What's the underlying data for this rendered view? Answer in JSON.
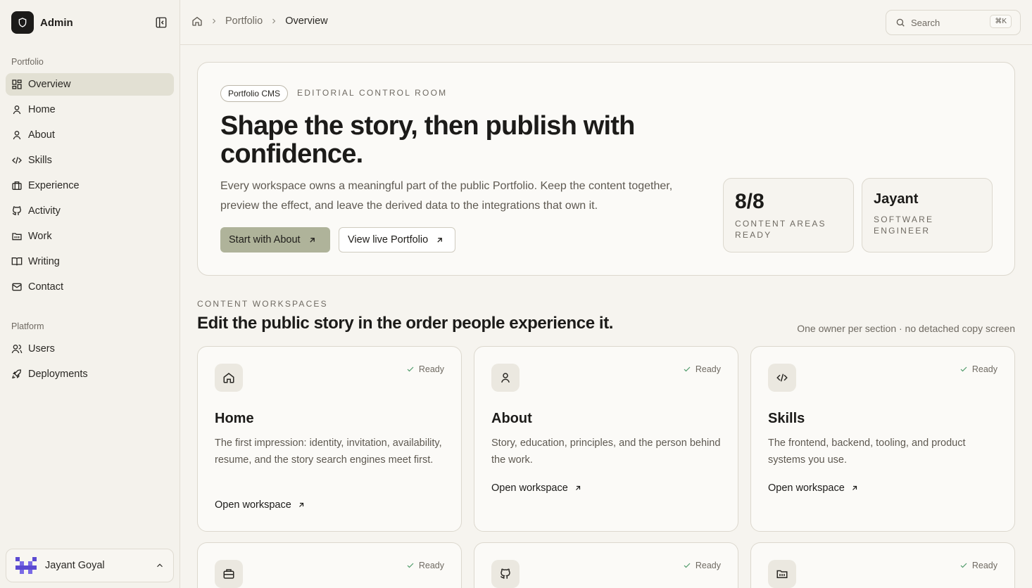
{
  "brand": {
    "name": "Admin"
  },
  "sidebar": {
    "groups": [
      {
        "label": "Portfolio"
      },
      {
        "label": "Platform"
      }
    ],
    "items": [
      {
        "label": "Overview"
      },
      {
        "label": "Home"
      },
      {
        "label": "About"
      },
      {
        "label": "Skills"
      },
      {
        "label": "Experience"
      },
      {
        "label": "Activity"
      },
      {
        "label": "Work"
      },
      {
        "label": "Writing"
      },
      {
        "label": "Contact"
      },
      {
        "label": "Users"
      },
      {
        "label": "Deployments"
      }
    ],
    "user": {
      "name": "Jayant Goyal"
    }
  },
  "header": {
    "breadcrumbs": [
      "Portfolio",
      "Overview"
    ],
    "search": {
      "placeholder": "Search",
      "shortcut": "⌘K"
    }
  },
  "hero": {
    "pill": "Portfolio CMS",
    "eyebrow": "EDITORIAL CONTROL ROOM",
    "title": "Shape the story, then publish with confidence.",
    "description": "Every workspace owns a meaningful part of the public Portfolio. Keep the content together, preview the effect, and leave the derived data to the integrations that own it.",
    "primary_button": "Start with About",
    "secondary_button": "View live Portfolio",
    "stats": [
      {
        "value": "8/8",
        "label": "CONTENT AREAS READY"
      },
      {
        "value": "Jayant",
        "label": "SOFTWARE ENGINEER"
      }
    ]
  },
  "workspaces": {
    "eyebrow": "CONTENT WORKSPACES",
    "title": "Edit the public story in the order people experience it.",
    "note": "One owner per section · no detached copy screen",
    "cards": [
      {
        "title": "Home",
        "status": "Ready",
        "description": "The first impression: identity, invitation, availability, resume, and the story search engines meet first.",
        "link": "Open workspace",
        "icon": "home-icon"
      },
      {
        "title": "About",
        "status": "Ready",
        "description": "Story, education, principles, and the person behind the work.",
        "link": "Open workspace",
        "icon": "user-icon"
      },
      {
        "title": "Skills",
        "status": "Ready",
        "description": "The frontend, backend, tooling, and product systems you use.",
        "link": "Open workspace",
        "icon": "code-icon"
      },
      {
        "status": "Ready",
        "icon": "briefcase-icon"
      },
      {
        "status": "Ready",
        "icon": "github-icon"
      },
      {
        "status": "Ready",
        "icon": "folder-icon"
      }
    ]
  }
}
